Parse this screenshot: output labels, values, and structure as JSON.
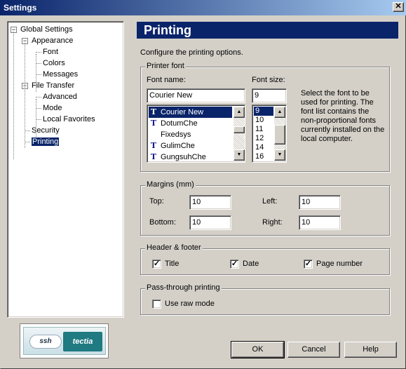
{
  "window": {
    "title": "Settings",
    "close_glyph": "✕"
  },
  "tree": {
    "items": [
      {
        "label": "Global Settings",
        "level": 0,
        "expander": "−"
      },
      {
        "label": "Appearance",
        "level": 1,
        "expander": "−"
      },
      {
        "label": "Font",
        "level": 2
      },
      {
        "label": "Colors",
        "level": 2
      },
      {
        "label": "Messages",
        "level": 2
      },
      {
        "label": "File Transfer",
        "level": 1,
        "expander": "−"
      },
      {
        "label": "Advanced",
        "level": 2
      },
      {
        "label": "Mode",
        "level": 2
      },
      {
        "label": "Local Favorites",
        "level": 2
      },
      {
        "label": "Security",
        "level": 1
      },
      {
        "label": "Printing",
        "level": 1,
        "selected": true
      }
    ]
  },
  "logo": {
    "left_text": "ssh",
    "right_text": "tectia"
  },
  "page": {
    "title": "Printing",
    "description": "Configure the printing options."
  },
  "printer_font": {
    "group_title": "Printer font",
    "font_name_label": "Font name:",
    "font_name_value": "Courier New",
    "font_size_label": "Font size:",
    "font_size_value": "9",
    "font_list": [
      {
        "name": "Courier New",
        "truetype": true,
        "selected": true
      },
      {
        "name": "DotumChe",
        "truetype": true
      },
      {
        "name": "Fixedsys",
        "truetype": false
      },
      {
        "name": "GulimChe",
        "truetype": true
      },
      {
        "name": "GungsuhChe",
        "truetype": true
      }
    ],
    "size_list": [
      "9",
      "10",
      "11",
      "12",
      "14",
      "16"
    ],
    "selected_size": "9",
    "truetype_glyph": "T",
    "info": "Select the font to be used for printing. The font list contains the non-proportional fonts currently installed on the local computer."
  },
  "margins": {
    "group_title": "Margins (mm)",
    "top_label": "Top:",
    "top_value": "10",
    "left_label": "Left:",
    "left_value": "10",
    "bottom_label": "Bottom:",
    "bottom_value": "10",
    "right_label": "Right:",
    "right_value": "10"
  },
  "header_footer": {
    "group_title": "Header & footer",
    "title_label": "Title",
    "title_checked": true,
    "date_label": "Date",
    "date_checked": true,
    "page_label": "Page number",
    "page_checked": true
  },
  "passthrough": {
    "group_title": "Pass-through printing",
    "raw_label": "Use raw mode",
    "raw_checked": false
  },
  "buttons": {
    "ok": "OK",
    "cancel": "Cancel",
    "help": "Help"
  },
  "scroll_glyphs": {
    "up": "▲",
    "down": "▼"
  },
  "check_glyph": "✓"
}
